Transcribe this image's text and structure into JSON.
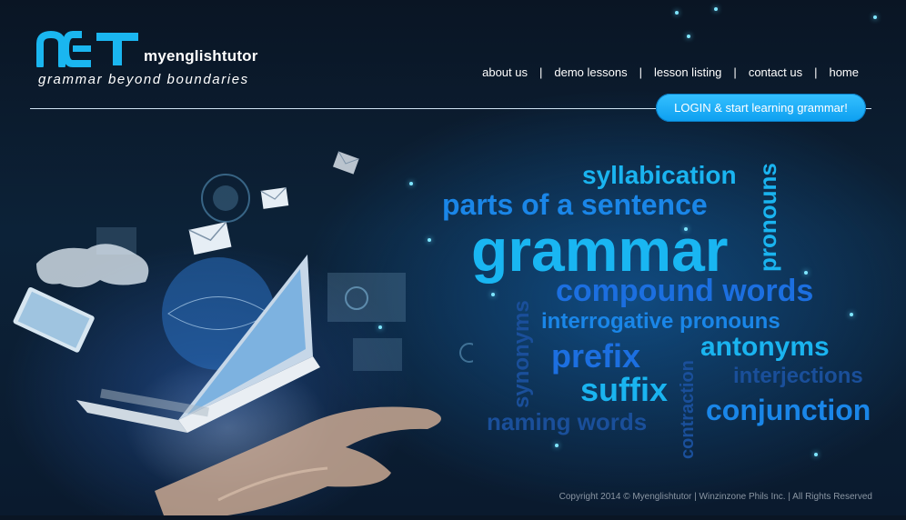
{
  "header": {
    "logo_letters": "NET",
    "brand": "myenglishtutor",
    "tagline": "grammar beyond boundaries"
  },
  "nav": {
    "items": [
      "about us",
      "demo lessons",
      "lesson listing",
      "contact us",
      "home"
    ],
    "separator": "|"
  },
  "login_button": "LOGIN & start learning grammar!",
  "word_cloud": {
    "syllabication": "syllabication",
    "pronouns": "pronouns",
    "parts_of_sentence": "parts of a sentence",
    "grammar": "grammar",
    "compound_words": "compound words",
    "synonyms": "synonyms",
    "interrogative_pronouns": "interrogative pronouns",
    "antonyms": "antonyms",
    "prefix": "prefix",
    "interjections": "interjections",
    "suffix": "suffix",
    "contraction": "contraction",
    "conjunction": "conjunction",
    "naming_words": "naming words"
  },
  "footer": {
    "copyright": "Copyright 2014 © Myenglishtutor | Winzinzone Phils Inc. | All Rights Reserved"
  },
  "colors": {
    "accent": "#1aa9f5",
    "bright_blue": "#1ab8f0",
    "mid_blue": "#1c6fe0",
    "dark_blue": "#1a4f9a",
    "background": "#0c2238"
  },
  "icons": [
    "envelope-icon",
    "laptop-icon",
    "tablet-icon",
    "world-map-icon",
    "globe-icon",
    "hand-icon"
  ]
}
